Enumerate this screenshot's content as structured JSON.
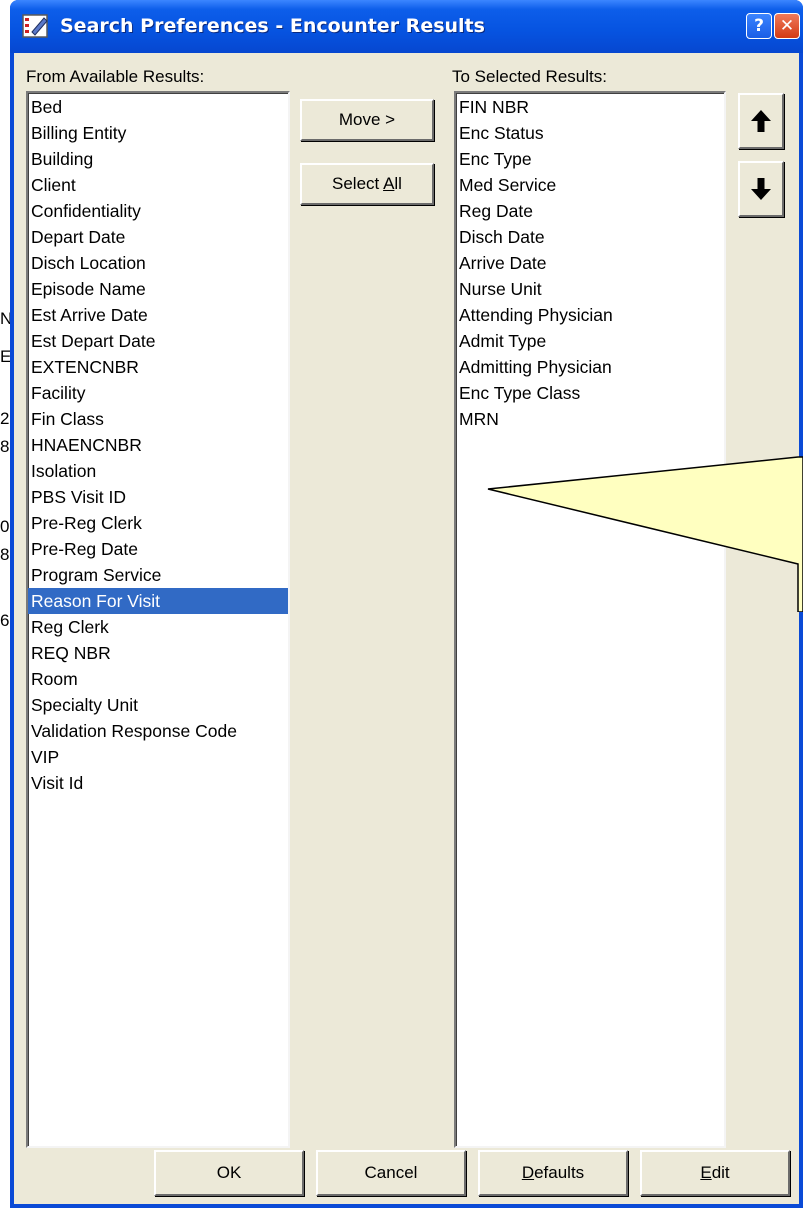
{
  "window": {
    "title": "Search Preferences - Encounter Results",
    "help_glyph": "?",
    "close_glyph": "✕"
  },
  "background_fragments": [
    "N",
    "E",
    "2",
    "8",
    "0",
    "8",
    "6"
  ],
  "available": {
    "label": "From Available Results:",
    "items": [
      "Bed",
      "Billing Entity",
      "Building",
      "Client",
      "Confidentiality",
      "Depart Date",
      "Disch Location",
      "Episode Name",
      "Est Arrive Date",
      "Est Depart Date",
      "EXTENCNBR",
      "Facility",
      "Fin Class",
      "HNAENCNBR",
      "Isolation",
      "PBS Visit ID",
      "Pre-Reg Clerk",
      "Pre-Reg Date",
      "Program Service",
      "Reason For Visit",
      "Reg Clerk",
      "REQ NBR",
      "Room",
      "Specialty Unit",
      "Validation Response Code",
      "VIP",
      "Visit Id"
    ],
    "selected": "Reason For Visit"
  },
  "selected": {
    "label": "To Selected Results:",
    "items": [
      "FIN NBR",
      "Enc Status",
      "Enc Type",
      "Med Service",
      "Reg Date",
      "Disch Date",
      "Arrive Date",
      "Nurse Unit",
      "Attending Physician",
      "Admit Type",
      "Admitting Physician",
      "Enc Type Class",
      "MRN"
    ]
  },
  "buttons": {
    "move": "Move >",
    "select_all": "Select All",
    "move_up_icon": "arrow-up-icon",
    "move_down_icon": "arrow-down-icon",
    "ok": "OK",
    "cancel": "Cancel",
    "defaults": "Defaults",
    "edit": "Edit"
  },
  "colors": {
    "title_bar": "#0653e0",
    "dialog_face": "#ece9d8",
    "selection": "#316ac5",
    "callout_fill": "#ffffc0"
  }
}
